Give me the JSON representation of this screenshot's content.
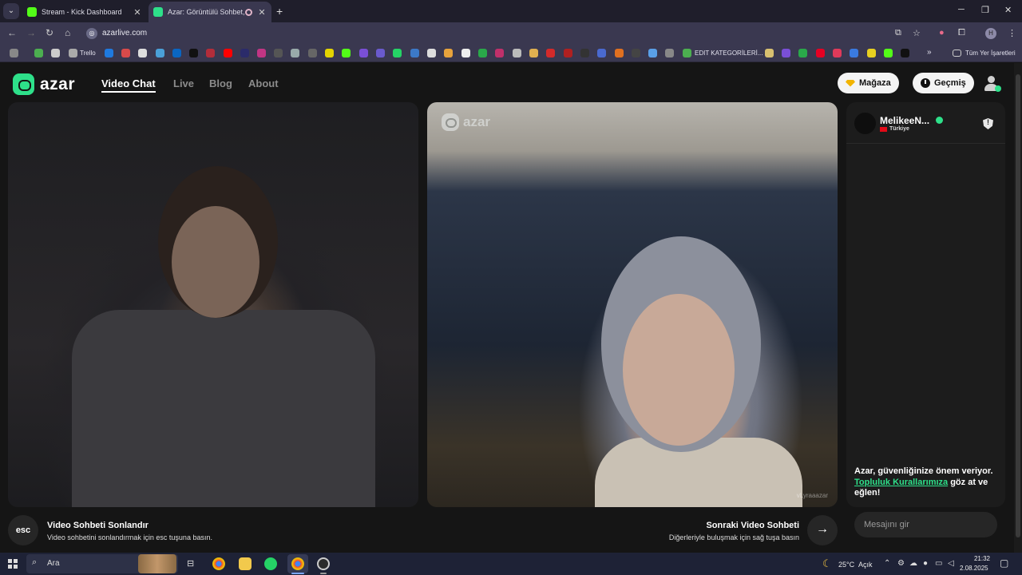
{
  "browser": {
    "tabs": [
      {
        "title": "Stream - Kick Dashboard",
        "favicon_color": "#53fc18"
      },
      {
        "title": "Azar: Görüntülü Sohbet, Arı",
        "favicon_color": "#2ee08a"
      }
    ],
    "url": "azarlive.com",
    "profile_initial": "H",
    "bookmarks": {
      "trello": "Trello",
      "edit_categories": "EDIT KATEGORİLERİ...",
      "all_bookmarks": "Tüm Yer İşaretleri",
      "overflow": "»"
    }
  },
  "site": {
    "brand": "azar",
    "nav": [
      "Video Chat",
      "Live",
      "Blog",
      "About"
    ],
    "shop_button": "Mağaza",
    "history_button": "Geçmiş",
    "peer_watermark": "azar",
    "peer_handle": "vLyraaazar",
    "peer": {
      "name": "MelikeeN...",
      "country": "Türkiye"
    },
    "safety": {
      "line1": "Azar, güvenliğinize önem veriyor.",
      "rules_link": "Topluluk Kurallarımıza",
      "line2": " göz at ve eğlen!"
    },
    "bottom": {
      "esc_key": "esc",
      "end_title": "Video Sohbeti Sonlandır",
      "end_sub": "Video sohbetini sonlandırmak için esc tuşuna basın.",
      "next_title": "Sonraki Video Sohbeti",
      "next_sub": "Diğerleriyle buluşmak için sağ tuşa basın",
      "next_arrow": "→",
      "message_placeholder": "Mesajını gir"
    }
  },
  "taskbar": {
    "search_placeholder": "Ara",
    "weather_temp": "25°C",
    "weather_text": "Açık",
    "time": "21:32",
    "date": "2.08.2025"
  },
  "colors": {
    "accent": "#2ee08a",
    "page_bg": "#151515",
    "chrome_bg": "#3a3850"
  }
}
